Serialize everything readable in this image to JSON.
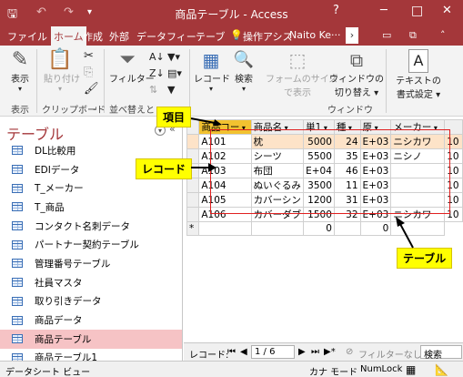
{
  "titlebar": {
    "title": "商品テーブル - Access",
    "help": "?",
    "minimize": "─",
    "maximize": "□",
    "close": "✕"
  },
  "ribbon_tabs": [
    "ファイル",
    "ホーム",
    "作成",
    "外部",
    "データ",
    "フィー",
    "テーブ"
  ],
  "tell_me": "操作アシス",
  "user": "Naito Ke···",
  "ribbon": {
    "view": "表示",
    "paste": "貼り付け",
    "filter": "フィルター",
    "records": "レコード",
    "find": "検索",
    "fit_form_1": "フォームのサイズ",
    "fit_form_2": "で表示",
    "switch_win_1": "ウィンドウの",
    "switch_win_2": "切り替え",
    "text_fmt_1": "テキストの",
    "text_fmt_2": "書式設定",
    "group_view": "表示",
    "group_clipboard": "クリップボード",
    "group_sort": "並べ替えと",
    "group_window": "ウィンドウ"
  },
  "nav": {
    "title": "テーブル",
    "items": [
      "DL比較用",
      "EDIデータ",
      "T_メーカー",
      "T_商品",
      "コンタクト名刺データ",
      "パートナー契約テーブル",
      "管理番号テーブル",
      "社員マスタ",
      "取り引きデータ",
      "商品データ",
      "商品テーブル",
      "商品テーブル1"
    ],
    "selected_index": 10
  },
  "datasheet": {
    "columns": [
      "商品コー",
      "商品名",
      "単1",
      "種",
      "原",
      "メーカー"
    ],
    "rows": [
      [
        "A101",
        "枕",
        "5000",
        "24",
        "E+03",
        "ニシカワ",
        "10"
      ],
      [
        "A102",
        "シーツ",
        "5500",
        "35",
        "E+03",
        "ニシノ",
        "10"
      ],
      [
        "A103",
        "布団",
        "E+04",
        "46",
        "E+03",
        "",
        "10"
      ],
      [
        "A104",
        "ぬいぐるみ",
        "3500",
        "11",
        "E+03",
        "",
        "10"
      ],
      [
        "A105",
        "カバーシン",
        "1200",
        "31",
        "E+03",
        "",
        "10"
      ],
      [
        "A106",
        "カバーダブ",
        "1500",
        "32",
        "E+03",
        "ニシカワ",
        "10"
      ]
    ],
    "new_row": [
      "*",
      "",
      "",
      "0",
      "",
      "0"
    ],
    "current_row": 0
  },
  "record_nav": {
    "label": "レコード:",
    "position": "1 / 6",
    "filter": "フィルターなし",
    "search": "検索"
  },
  "status": {
    "left": "データシート ビュー",
    "kana": "カナ モード",
    "numlock": "NumLock"
  },
  "callouts": {
    "field": "項目",
    "record": "レコード",
    "table": "テーブル"
  },
  "colors": {
    "accent": "#a4373a",
    "callout": "#ffff00",
    "outline": "#e02020"
  }
}
